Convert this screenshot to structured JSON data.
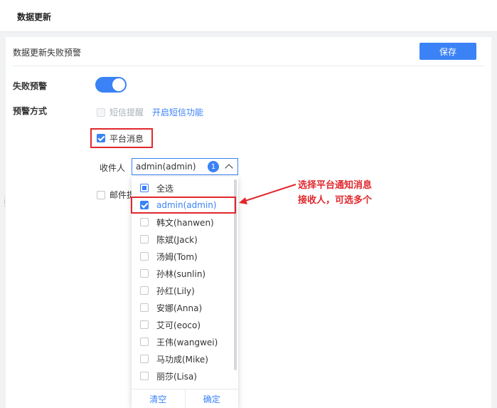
{
  "header": {
    "title": "数据更新"
  },
  "panel": {
    "title": "数据更新失败预警",
    "save_label": "保存",
    "fail_alert_label": "失败预警",
    "fail_alert_on": true,
    "alert_method_label": "预警方式",
    "sms": {
      "label": "短信提醒",
      "enable_link": "开启短信功能",
      "disabled": true
    },
    "platform": {
      "label": "平台消息",
      "checked": true
    },
    "receiver": {
      "label": "收件人",
      "value": "admin(admin)",
      "count": "1"
    },
    "mail": {
      "label": "邮件提醒",
      "checked": false
    }
  },
  "dropdown": {
    "select_all": "全选",
    "items": [
      {
        "label": "admin(admin)",
        "checked": true
      },
      {
        "label": "韩文(hanwen)",
        "checked": false
      },
      {
        "label": "陈斌(Jack)",
        "checked": false
      },
      {
        "label": "汤姆(Tom)",
        "checked": false
      },
      {
        "label": "孙林(sunlin)",
        "checked": false
      },
      {
        "label": "孙红(Lily)",
        "checked": false
      },
      {
        "label": "安娜(Anna)",
        "checked": false
      },
      {
        "label": "艾可(eoco)",
        "checked": false
      },
      {
        "label": "王伟(wangwei)",
        "checked": false
      },
      {
        "label": "马功成(Mike)",
        "checked": false
      },
      {
        "label": "丽莎(Lisa)",
        "checked": false
      }
    ],
    "clear_label": "清空",
    "confirm_label": "确定"
  },
  "annotation": {
    "line1": "选择平台通知消息",
    "line2": "接收人，可选多个"
  },
  "colors": {
    "accent": "#3b82f6",
    "highlight": "#e0282d"
  }
}
